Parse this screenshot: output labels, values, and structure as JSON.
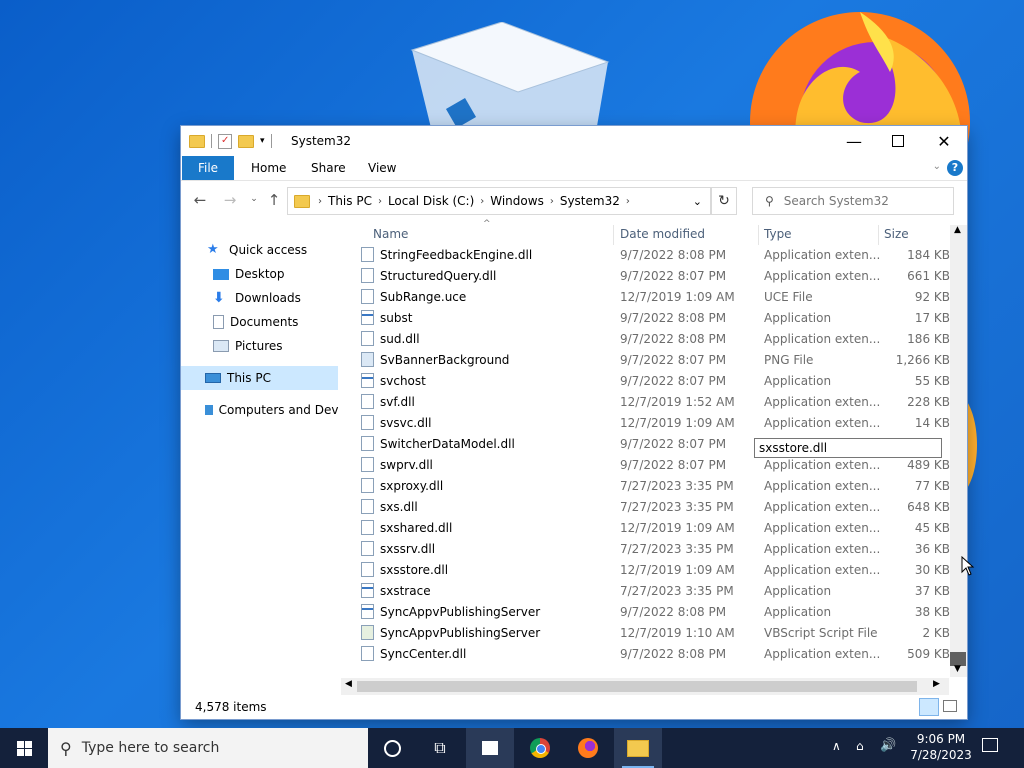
{
  "window": {
    "title": "System32"
  },
  "ribbon": {
    "tabs": [
      "File",
      "Home",
      "Share",
      "View"
    ]
  },
  "address": {
    "crumbs": [
      "This PC",
      "Local Disk (C:)",
      "Windows",
      "System32"
    ]
  },
  "search": {
    "placeholder": "Search System32"
  },
  "nav": {
    "quick_access": "Quick access",
    "desktop": "Desktop",
    "downloads": "Downloads",
    "documents": "Documents",
    "pictures": "Pictures",
    "this_pc": "This PC",
    "network": "Computers and Devices"
  },
  "columns": {
    "name": "Name",
    "date": "Date modified",
    "type": "Type",
    "size": "Size"
  },
  "files": [
    {
      "name": "StringFeedbackEngine.dll",
      "date": "9/7/2022 8:08 PM",
      "type": "Application exten...",
      "size": "184 KB",
      "icon": "dll"
    },
    {
      "name": "StructuredQuery.dll",
      "date": "9/7/2022 8:07 PM",
      "type": "Application exten...",
      "size": "661 KB",
      "icon": "dll"
    },
    {
      "name": "SubRange.uce",
      "date": "12/7/2019 1:09 AM",
      "type": "UCE File",
      "size": "92 KB",
      "icon": "file"
    },
    {
      "name": "subst",
      "date": "9/7/2022 8:08 PM",
      "type": "Application",
      "size": "17 KB",
      "icon": "exe"
    },
    {
      "name": "sud.dll",
      "date": "9/7/2022 8:08 PM",
      "type": "Application exten...",
      "size": "186 KB",
      "icon": "dll"
    },
    {
      "name": "SvBannerBackground",
      "date": "9/7/2022 8:07 PM",
      "type": "PNG File",
      "size": "1,266 KB",
      "icon": "png"
    },
    {
      "name": "svchost",
      "date": "9/7/2022 8:07 PM",
      "type": "Application",
      "size": "55 KB",
      "icon": "exe"
    },
    {
      "name": "svf.dll",
      "date": "12/7/2019 1:52 AM",
      "type": "Application exten...",
      "size": "228 KB",
      "icon": "dll"
    },
    {
      "name": "svsvc.dll",
      "date": "12/7/2019 1:09 AM",
      "type": "Application exten...",
      "size": "14 KB",
      "icon": "dll"
    },
    {
      "name": "SwitcherDataModel.dll",
      "date": "9/7/2022 8:07 PM",
      "type": "",
      "size": "",
      "icon": "dll"
    },
    {
      "name": "swprv.dll",
      "date": "9/7/2022 8:07 PM",
      "type": "Application exten...",
      "size": "489 KB",
      "icon": "dll"
    },
    {
      "name": "sxproxy.dll",
      "date": "7/27/2023 3:35 PM",
      "type": "Application exten...",
      "size": "77 KB",
      "icon": "dll"
    },
    {
      "name": "sxs.dll",
      "date": "7/27/2023 3:35 PM",
      "type": "Application exten...",
      "size": "648 KB",
      "icon": "dll"
    },
    {
      "name": "sxshared.dll",
      "date": "12/7/2019 1:09 AM",
      "type": "Application exten...",
      "size": "45 KB",
      "icon": "dll"
    },
    {
      "name": "sxssrv.dll",
      "date": "7/27/2023 3:35 PM",
      "type": "Application exten...",
      "size": "36 KB",
      "icon": "dll"
    },
    {
      "name": "sxsstore.dll",
      "date": "12/7/2019 1:09 AM",
      "type": "Application exten...",
      "size": "30 KB",
      "icon": "dll"
    },
    {
      "name": "sxstrace",
      "date": "7/27/2023 3:35 PM",
      "type": "Application",
      "size": "37 KB",
      "icon": "exe"
    },
    {
      "name": "SyncAppvPublishingServer",
      "date": "9/7/2022 8:08 PM",
      "type": "Application",
      "size": "38 KB",
      "icon": "exe"
    },
    {
      "name": "SyncAppvPublishingServer",
      "date": "12/7/2019 1:10 AM",
      "type": "VBScript Script File",
      "size": "2 KB",
      "icon": "vbs"
    },
    {
      "name": "SyncCenter.dll",
      "date": "9/7/2022 8:08 PM",
      "type": "Application exten...",
      "size": "509 KB",
      "icon": "dll"
    }
  ],
  "tooltip": "sxsstore.dll",
  "status": {
    "items": "4,578 items"
  },
  "taskbar": {
    "search_placeholder": "Type here to search",
    "time": "9:06 PM",
    "date": "7/28/2023"
  },
  "colors": {
    "accent": "#1979ca",
    "desktop": "#1565c8",
    "taskbar": "#14213b"
  }
}
